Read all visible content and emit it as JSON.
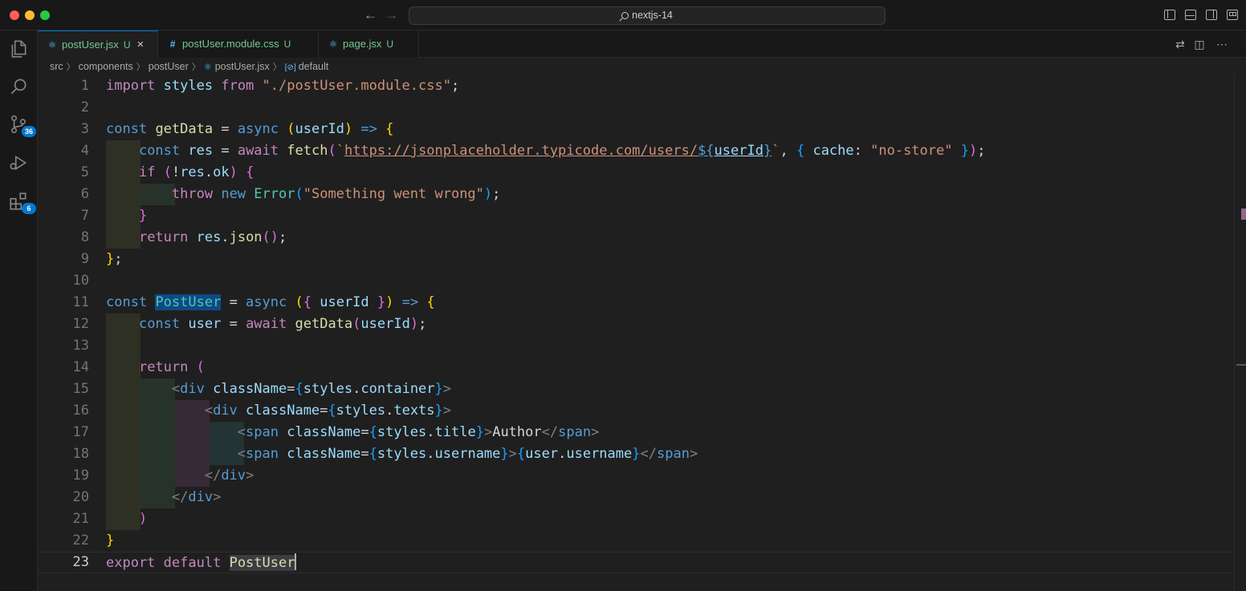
{
  "window": {
    "title": "nextjs-14"
  },
  "tabs": [
    {
      "label": "postUser.jsx",
      "status": "U",
      "icon": "react-icon",
      "active": true
    },
    {
      "label": "postUser.module.css",
      "status": "U",
      "icon": "css-icon",
      "active": false
    },
    {
      "label": "page.jsx",
      "status": "U",
      "icon": "react-icon",
      "active": false
    }
  ],
  "breadcrumb": [
    "src",
    "components",
    "postUser",
    "postUser.jsx",
    "default"
  ],
  "activity": {
    "scm_badge": "36",
    "extensions_badge": "6"
  },
  "editor": {
    "current_line": 23,
    "line_numbers": [
      "1",
      "2",
      "3",
      "4",
      "5",
      "6",
      "7",
      "8",
      "9",
      "10",
      "11",
      "12",
      "13",
      "14",
      "15",
      "16",
      "17",
      "18",
      "19",
      "20",
      "21",
      "22",
      "23"
    ]
  },
  "colors": {
    "keyword": "#569cd6",
    "control": "#c586c0",
    "variable": "#9cdcfe",
    "function": "#dcdcaa",
    "string": "#ce9178",
    "class": "#4ec9b0",
    "accent": "#0078d4",
    "untracked": "#73c991"
  }
}
